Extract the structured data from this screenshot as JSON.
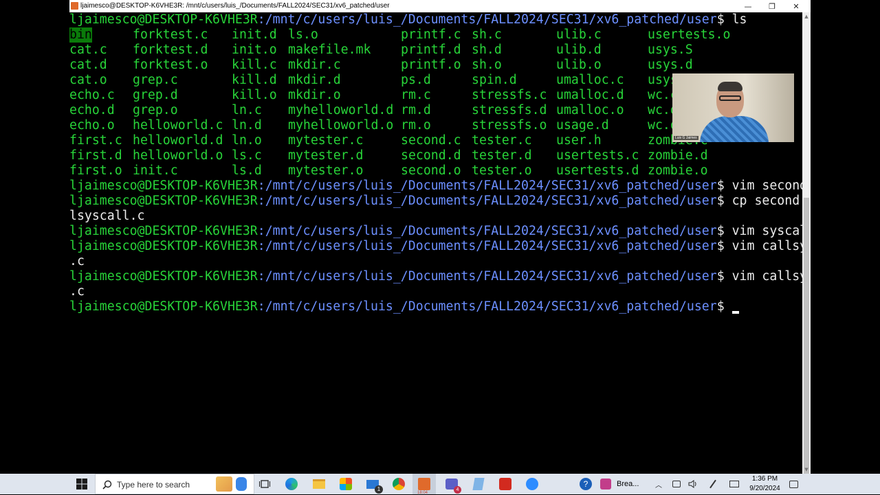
{
  "window": {
    "title": "ljaimesco@DESKTOP-K6VHE3R: /mnt/c/users/luis_/Documents/FALL2024/SEC31/xv6_patched/user",
    "minimize": "—",
    "maximize": "❐",
    "close": "✕"
  },
  "terminal": {
    "prompt_user": "ljaimesco@DESKTOP-K6VHE3R",
    "prompt_path": ":/mnt/c/users/luis_/Documents/FALL2024/SEC31/xv6_patched/user",
    "prompt_sign": "$",
    "cmd_ls": " ls",
    "listing": [
      [
        "bin",
        "forktest.c",
        "init.d",
        "ls.o",
        "printf.c",
        "sh.c",
        "ulib.c",
        "usertests.o"
      ],
      [
        "cat.c",
        "forktest.d",
        "init.o",
        "makefile.mk",
        "printf.d",
        "sh.d",
        "ulib.d",
        "usys.S"
      ],
      [
        "cat.d",
        "forktest.o",
        "kill.c",
        "mkdir.c",
        "printf.o",
        "sh.o",
        "ulib.o",
        "usys.d"
      ],
      [
        "cat.o",
        "grep.c",
        "kill.d",
        "mkdir.d",
        "ps.d",
        "spin.d",
        "umalloc.c",
        "usys.o"
      ],
      [
        "echo.c",
        "grep.d",
        "kill.o",
        "mkdir.o",
        "rm.c",
        "stressfs.c",
        "umalloc.d",
        "wc.c"
      ],
      [
        "echo.d",
        "grep.o",
        "ln.c",
        "myhelloworld.d",
        "rm.d",
        "stressfs.d",
        "umalloc.o",
        "wc.d"
      ],
      [
        "echo.o",
        "helloworld.c",
        "ln.d",
        "myhelloworld.o",
        "rm.o",
        "stressfs.o",
        "usage.d",
        "wc.o"
      ],
      [
        "first.c",
        "helloworld.d",
        "ln.o",
        "mytester.c",
        "second.c",
        "tester.c",
        "user.h",
        "zombie.c"
      ],
      [
        "first.d",
        "helloworld.o",
        "ls.c",
        "mytester.d",
        "second.d",
        "tester.d",
        "usertests.c",
        "zombie.d"
      ],
      [
        "first.o",
        "init.c",
        "ls.d",
        "mytester.o",
        "second.o",
        "tester.o",
        "usertests.d",
        "zombie.o"
      ]
    ],
    "cmd_vim_second": " vim second.c",
    "cmd_cp_1": " cp second.c cal",
    "cmd_cp_2": "lsyscall.c",
    "cmd_vim_syscall": " vim syscall.c",
    "cmd_vim_call_1": " vim callsyscall",
    "cmd_vim_call_2": ".c",
    "cmd_vim_call_again_1": " vim callsyscall",
    "cmd_vim_call_again_2": ".c"
  },
  "webcam": {
    "name_tag": "Luis G Jaimes"
  },
  "taskbar": {
    "search_placeholder": "Type here to search",
    "app_label": "Brea...",
    "mail_badge": "1",
    "teams_badge": "4",
    "date_icon_label": "18:04",
    "time": "1:36 PM",
    "date": "9/20/2024"
  },
  "colors": {
    "prompt_user": "#28d439",
    "prompt_path": "#6c8fff",
    "file_text": "#28d439"
  }
}
